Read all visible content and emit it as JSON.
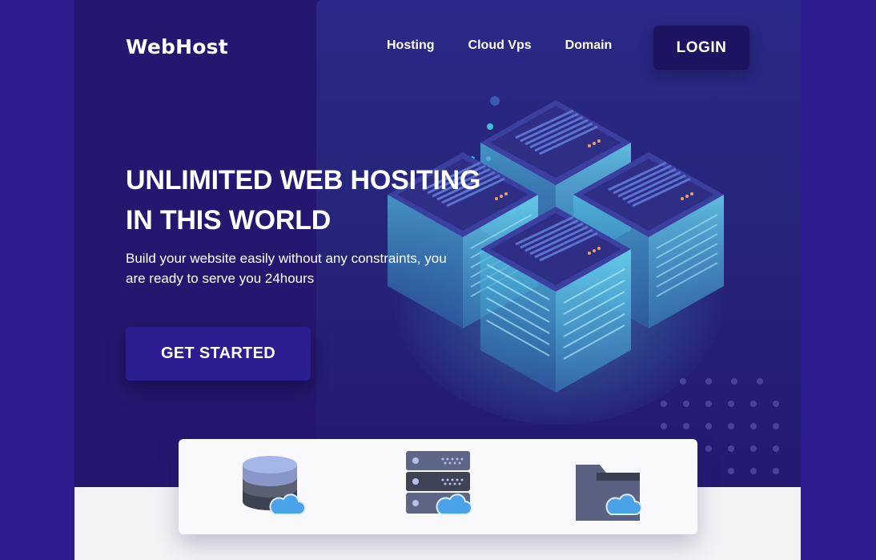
{
  "brand": {
    "name": "WebHost"
  },
  "nav": {
    "items": [
      {
        "label": "Hosting"
      },
      {
        "label": "Cloud Vps"
      },
      {
        "label": "Domain"
      }
    ],
    "login_label": "LOGIN"
  },
  "hero": {
    "headline": "UNLIMITED WEB HOSITING IN THIS WORLD",
    "subtitle": "Build your website easily without any constraints, you are ready to serve you 24hours",
    "cta_label": "GET STARTED"
  },
  "features": {
    "icons": [
      "database-cloud-icon",
      "server-rack-cloud-icon",
      "folder-cloud-icon"
    ]
  },
  "colors": {
    "page_bg": "#2d1b8f",
    "hero_bg": "#25176f",
    "button_bg": "#2c1c92",
    "login_bg": "#1d1461",
    "server_cyan": "#4fc3e6",
    "cloud_blue": "#4aa3e8"
  }
}
